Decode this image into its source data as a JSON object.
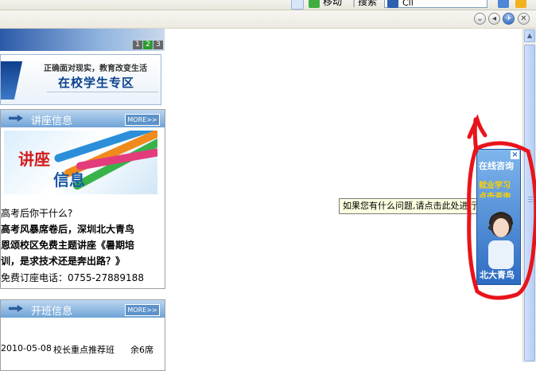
{
  "toolbar": {
    "item1_label": "移动",
    "item2_label": "搜索",
    "search_value": "Cll"
  },
  "window_buttons": {
    "b1": "⌄",
    "b2": "◂",
    "b3": "✈",
    "b4": "✕"
  },
  "banner": {
    "pages": [
      "1",
      "2",
      "3"
    ],
    "active_page": "2"
  },
  "student_zone": {
    "subtitle": "正确面对现实，教育改变生活",
    "title": "在校学生专区"
  },
  "lecture": {
    "header": "讲座信息",
    "more": "MORE>>",
    "image_text_1": "讲座",
    "image_text_2": "信息",
    "lines": [
      "高考后你干什么?",
      "  高考风暴席卷后，深圳北大青鸟",
      "恩颂校区免费主题讲座《暑期培",
      "训，是求技术还是奔出路？》",
      "免费订座电话：0755-27889188"
    ]
  },
  "classes": {
    "header": "开班信息",
    "more": "MORE>>",
    "row": {
      "date": "2010-05-08",
      "name": "校长重点推荐班",
      "seats": "余6席"
    }
  },
  "float_ad": {
    "online": "在线咨询",
    "job": "就业学习",
    "self": "点击咨询",
    "brand": "北大青鸟",
    "close": "×"
  },
  "tooltip": "如果您有什么问题,请点击此处进行即时沟通!",
  "colors": {
    "brand_blue": "#2e6cc3",
    "annotation_red": "#e8141b"
  }
}
